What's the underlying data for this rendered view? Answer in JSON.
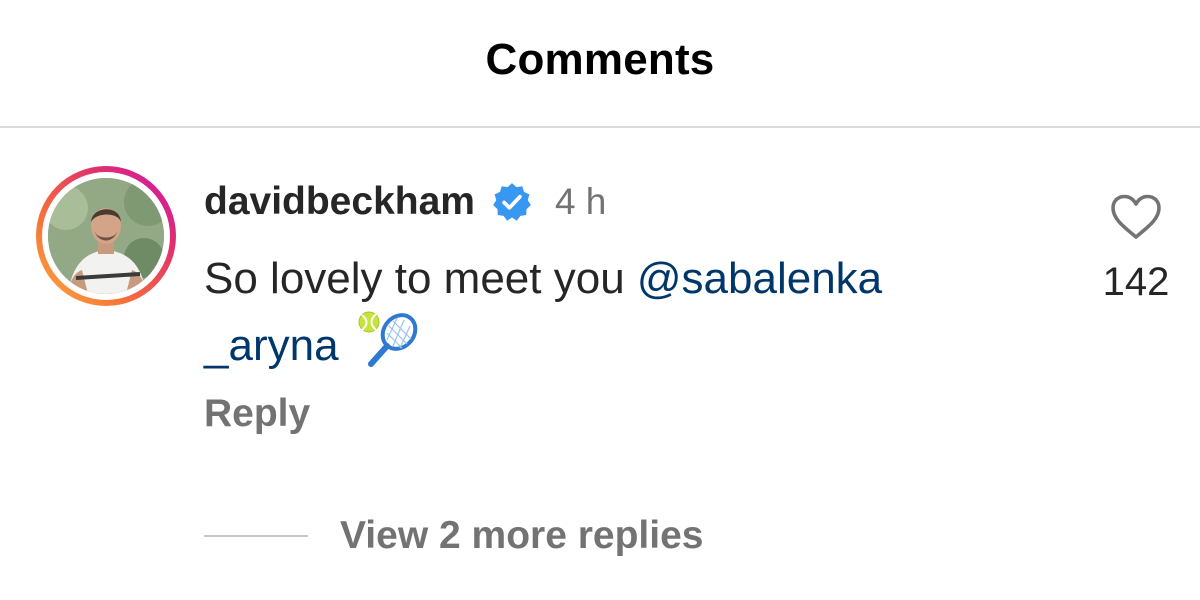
{
  "header": {
    "title": "Comments"
  },
  "comment": {
    "username": "davidbeckham",
    "verified": true,
    "time": "4 h",
    "text_before": "So lovely to meet you ",
    "mention": "@sabalenka\n_aryna",
    "emojis": [
      "tennis-ball-icon",
      "tennis-racket-icon"
    ],
    "reply_label": "Reply",
    "like_count": "142",
    "view_replies_label": "View 2 more replies"
  },
  "colors": {
    "text_primary": "#262626",
    "text_secondary": "#737373",
    "mention": "#00376b",
    "verified_blue": "#3897f0",
    "divider": "#dbdbdb"
  }
}
